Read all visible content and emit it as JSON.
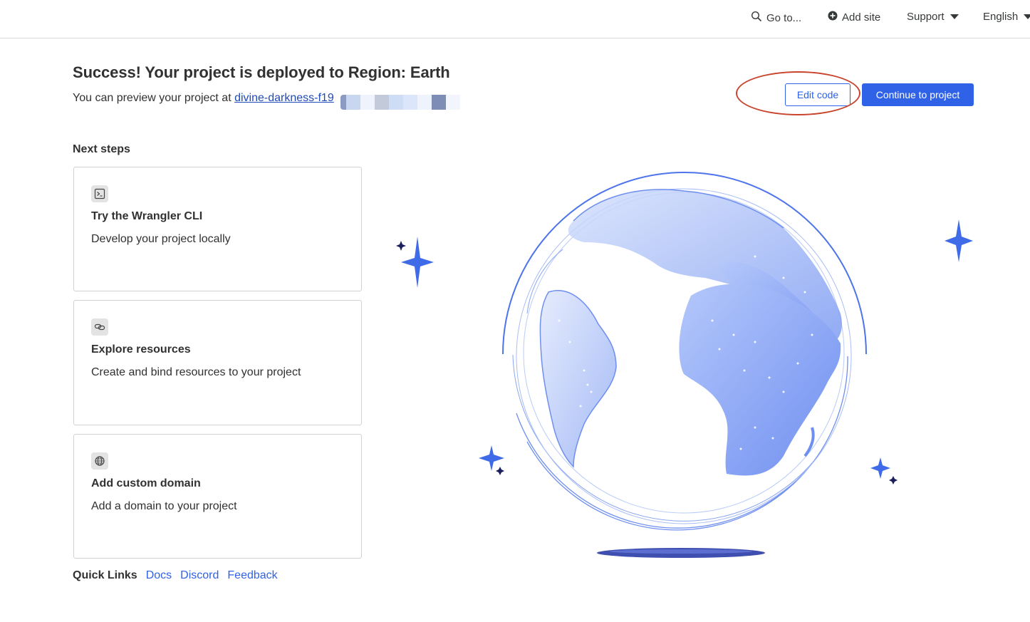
{
  "topnav": {
    "goto_label": "Go to...",
    "add_site_label": "Add site",
    "support_label": "Support",
    "language_label": "English"
  },
  "header": {
    "title": "Success! Your project is deployed to Region: Earth",
    "preview_prefix": "You can preview your project at ",
    "preview_link": "divine-darkness-f19"
  },
  "actions": {
    "edit_code_label": "Edit code",
    "continue_label": "Continue to project"
  },
  "next_steps": {
    "heading": "Next steps",
    "cards": [
      {
        "title": "Try the Wrangler CLI",
        "description": "Develop your project locally",
        "icon": "terminal-icon"
      },
      {
        "title": "Explore resources",
        "description": "Create and bind resources to your project",
        "icon": "link-icon"
      },
      {
        "title": "Add custom domain",
        "description": "Add a domain to your project",
        "icon": "globe-icon"
      }
    ]
  },
  "quick_links": {
    "label": "Quick Links",
    "links": [
      "Docs",
      "Discord",
      "Feedback"
    ]
  },
  "colors": {
    "accent": "#2f62e6",
    "annotation": "#c9442c",
    "globe_light": "#c7d6fb",
    "globe_dark": "#7e9cf2",
    "star": "#3f6be8",
    "star_dark": "#1a1f5c"
  }
}
